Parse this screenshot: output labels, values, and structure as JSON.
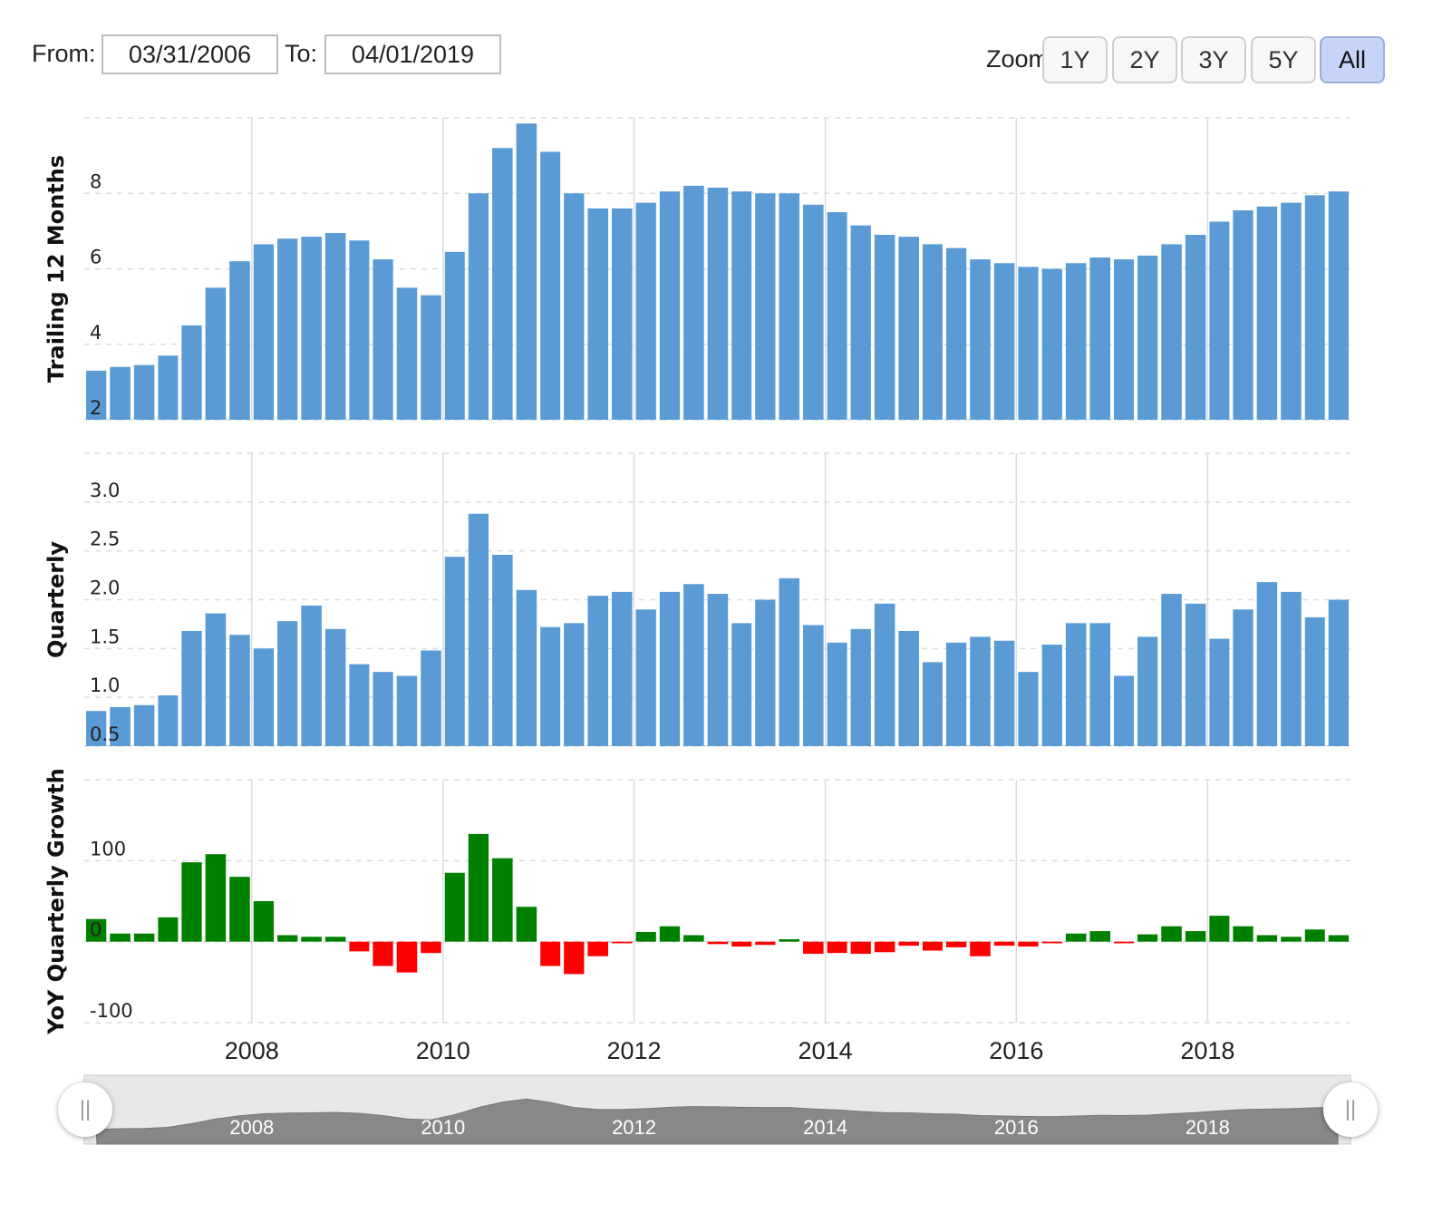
{
  "range": {
    "from_label": "From:",
    "from_value": "03/31/2006",
    "to_label": "To:",
    "to_value": "04/01/2019"
  },
  "zoom": {
    "label": "Zoom:",
    "buttons": [
      "1Y",
      "2Y",
      "3Y",
      "5Y",
      "All"
    ],
    "active": "All"
  },
  "colors": {
    "bar": "#5b9bd5",
    "positive": "#008000",
    "negative": "#ff0000",
    "grid": "#dddddd",
    "navigator_fill": "#888888",
    "navigator_bg": "#e8e8e8"
  },
  "chart_data": [
    {
      "type": "bar",
      "ylabel": "Trailing 12 Months",
      "yticks": [
        "2",
        "4",
        "6",
        "8"
      ],
      "ylim": [
        2,
        10
      ],
      "x": [
        "2006-Q2",
        "2006-Q3",
        "2006-Q4",
        "2007-Q1",
        "2007-Q2",
        "2007-Q3",
        "2007-Q4",
        "2008-Q1",
        "2008-Q2",
        "2008-Q3",
        "2008-Q4",
        "2009-Q1",
        "2009-Q2",
        "2009-Q3",
        "2009-Q4",
        "2010-Q1",
        "2010-Q2",
        "2010-Q3",
        "2010-Q4",
        "2011-Q1",
        "2011-Q2",
        "2011-Q3",
        "2011-Q4",
        "2012-Q1",
        "2012-Q2",
        "2012-Q3",
        "2012-Q4",
        "2013-Q1",
        "2013-Q2",
        "2013-Q3",
        "2013-Q4",
        "2014-Q1",
        "2014-Q2",
        "2014-Q3",
        "2014-Q4",
        "2015-Q1",
        "2015-Q2",
        "2015-Q3",
        "2015-Q4",
        "2016-Q1",
        "2016-Q2",
        "2016-Q3",
        "2016-Q4",
        "2017-Q1",
        "2017-Q2",
        "2017-Q3",
        "2017-Q4",
        "2018-Q1",
        "2018-Q2",
        "2018-Q3",
        "2018-Q4",
        "2019-Q1",
        "2019-Q2"
      ],
      "values": [
        3.3,
        3.4,
        3.45,
        3.7,
        4.5,
        5.5,
        6.2,
        6.65,
        6.8,
        6.85,
        6.95,
        6.75,
        6.25,
        5.5,
        5.3,
        6.45,
        8.0,
        9.2,
        9.85,
        9.1,
        8.0,
        7.6,
        7.6,
        7.75,
        8.05,
        8.2,
        8.15,
        8.05,
        8.0,
        8.0,
        7.7,
        7.5,
        7.15,
        6.9,
        6.85,
        6.65,
        6.55,
        6.25,
        6.15,
        6.05,
        6.0,
        6.15,
        6.3,
        6.25,
        6.35,
        6.65,
        6.9,
        7.25,
        7.55,
        7.65,
        7.75,
        7.95,
        8.05
      ]
    },
    {
      "type": "bar",
      "ylabel": "Quarterly",
      "yticks": [
        "0.5",
        "1.0",
        "1.5",
        "2.0",
        "2.5",
        "3.0"
      ],
      "ylim": [
        0.5,
        3.5
      ],
      "x": [
        "2006-Q2",
        "2006-Q3",
        "2006-Q4",
        "2007-Q1",
        "2007-Q2",
        "2007-Q3",
        "2007-Q4",
        "2008-Q1",
        "2008-Q2",
        "2008-Q3",
        "2008-Q4",
        "2009-Q1",
        "2009-Q2",
        "2009-Q3",
        "2009-Q4",
        "2010-Q1",
        "2010-Q2",
        "2010-Q3",
        "2010-Q4",
        "2011-Q1",
        "2011-Q2",
        "2011-Q3",
        "2011-Q4",
        "2012-Q1",
        "2012-Q2",
        "2012-Q3",
        "2012-Q4",
        "2013-Q1",
        "2013-Q2",
        "2013-Q3",
        "2013-Q4",
        "2014-Q1",
        "2014-Q2",
        "2014-Q3",
        "2014-Q4",
        "2015-Q1",
        "2015-Q2",
        "2015-Q3",
        "2015-Q4",
        "2016-Q1",
        "2016-Q2",
        "2016-Q3",
        "2016-Q4",
        "2017-Q1",
        "2017-Q2",
        "2017-Q3",
        "2017-Q4",
        "2018-Q1",
        "2018-Q2",
        "2018-Q3",
        "2018-Q4",
        "2019-Q1",
        "2019-Q2"
      ],
      "values": [
        0.86,
        0.9,
        0.92,
        1.02,
        1.68,
        1.86,
        1.64,
        1.5,
        1.78,
        1.94,
        1.7,
        1.34,
        1.26,
        1.22,
        1.48,
        2.44,
        2.88,
        2.46,
        2.1,
        1.72,
        1.76,
        2.04,
        2.08,
        1.9,
        2.08,
        2.16,
        2.06,
        1.76,
        2.0,
        2.22,
        1.74,
        1.56,
        1.7,
        1.96,
        1.68,
        1.36,
        1.56,
        1.62,
        1.58,
        1.26,
        1.54,
        1.76,
        1.76,
        1.22,
        1.62,
        2.06,
        1.96,
        1.6,
        1.9,
        2.18,
        2.08,
        1.82,
        2.0
      ]
    },
    {
      "type": "bar",
      "ylabel": "YoY Quarterly Growth",
      "yticks": [
        "-100",
        "0",
        "100"
      ],
      "ylim": [
        -100,
        200
      ],
      "x": [
        "2006-Q2",
        "2006-Q3",
        "2006-Q4",
        "2007-Q1",
        "2007-Q2",
        "2007-Q3",
        "2007-Q4",
        "2008-Q1",
        "2008-Q2",
        "2008-Q3",
        "2008-Q4",
        "2009-Q1",
        "2009-Q2",
        "2009-Q3",
        "2009-Q4",
        "2010-Q1",
        "2010-Q2",
        "2010-Q3",
        "2010-Q4",
        "2011-Q1",
        "2011-Q2",
        "2011-Q3",
        "2011-Q4",
        "2012-Q1",
        "2012-Q2",
        "2012-Q3",
        "2012-Q4",
        "2013-Q1",
        "2013-Q2",
        "2013-Q3",
        "2013-Q4",
        "2014-Q1",
        "2014-Q2",
        "2014-Q3",
        "2014-Q4",
        "2015-Q1",
        "2015-Q2",
        "2015-Q3",
        "2015-Q4",
        "2016-Q1",
        "2016-Q2",
        "2016-Q3",
        "2016-Q4",
        "2017-Q1",
        "2017-Q2",
        "2017-Q3",
        "2017-Q4",
        "2018-Q1",
        "2018-Q2",
        "2018-Q3",
        "2018-Q4",
        "2019-Q1",
        "2019-Q2"
      ],
      "values": [
        28,
        10,
        10,
        30,
        98,
        108,
        80,
        50,
        8,
        6,
        6,
        -12,
        -30,
        -38,
        -14,
        85,
        133,
        103,
        43,
        -30,
        -40,
        -18,
        -2,
        12,
        19,
        8,
        -3,
        -6,
        -4,
        3,
        -15,
        -14,
        -15,
        -13,
        -5,
        -11,
        -7,
        -18,
        -5,
        -6,
        -2,
        10,
        13,
        -2,
        9,
        19,
        13,
        32,
        19,
        8,
        6,
        15,
        8
      ]
    }
  ],
  "x_axis": {
    "ticks": [
      "2008",
      "2010",
      "2012",
      "2014",
      "2016",
      "2018"
    ],
    "tick_dates": [
      "2008-01-01",
      "2010-01-01",
      "2012-01-01",
      "2014-01-01",
      "2016-01-01",
      "2018-01-01"
    ]
  },
  "navigator": {
    "labels": [
      "2008",
      "2010",
      "2012",
      "2014",
      "2016",
      "2018"
    ],
    "handle_glyph": "||"
  }
}
